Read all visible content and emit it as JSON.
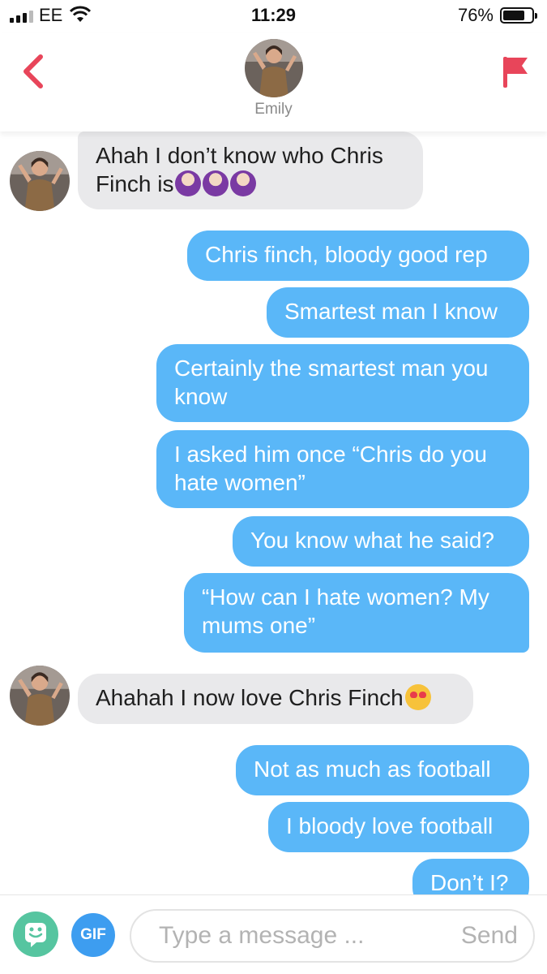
{
  "status_bar": {
    "carrier": "EE",
    "time": "11:29",
    "battery": "76%",
    "battery_level": 0.76
  },
  "header": {
    "contact_name": "Emily",
    "back_icon": "chevron-left-icon",
    "report_icon": "flag-icon"
  },
  "messages": [
    {
      "sender": "them",
      "text": "Ahah I don’t know who Chris Finch is",
      "emoji": "woman-shrugging x3"
    },
    {
      "sender": "me",
      "text": "Chris finch, bloody good rep"
    },
    {
      "sender": "me",
      "text": "Smartest man I know"
    },
    {
      "sender": "me",
      "text": "Certainly the smartest man you know"
    },
    {
      "sender": "me",
      "text": "I asked him once “Chris do you hate women”"
    },
    {
      "sender": "me",
      "text": "You know what he said?"
    },
    {
      "sender": "me",
      "text": "“How can I hate women? My mums one”"
    },
    {
      "sender": "them",
      "text": "Ahahah I now love Chris Finch",
      "emoji": "smiling-face-with-heart-eyes"
    },
    {
      "sender": "me",
      "text": "Not as much as football"
    },
    {
      "sender": "me",
      "text": "I bloody love football"
    },
    {
      "sender": "me",
      "text": "Don’t I?"
    }
  ],
  "composer": {
    "gif_label": "GIF",
    "placeholder": "Type a message ...",
    "send_label": "Send"
  },
  "colors": {
    "accent_red": "#e8455a",
    "outgoing_bubble": "#5ab7f8",
    "incoming_bubble": "#e9e9eb",
    "sticker_button": "#56c5a0",
    "gif_button": "#3d9df0"
  }
}
